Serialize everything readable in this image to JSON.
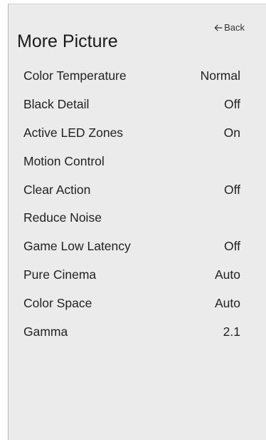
{
  "panel": {
    "title": "More Picture",
    "back_label": "Back",
    "back_icon": "arrow-left-icon"
  },
  "menu": {
    "items": [
      {
        "label": "Color Temperature",
        "value": "Normal"
      },
      {
        "label": "Black Detail",
        "value": "Off"
      },
      {
        "label": "Active LED Zones",
        "value": "On"
      },
      {
        "label": "Motion Control",
        "value": ""
      },
      {
        "label": "Clear Action",
        "value": "Off"
      },
      {
        "label": "Reduce Noise",
        "value": ""
      },
      {
        "label": "Game Low Latency",
        "value": "Off"
      },
      {
        "label": "Pure Cinema",
        "value": "Auto"
      },
      {
        "label": "Color Space",
        "value": "Auto"
      },
      {
        "label": "Gamma",
        "value": "2.1"
      }
    ]
  }
}
